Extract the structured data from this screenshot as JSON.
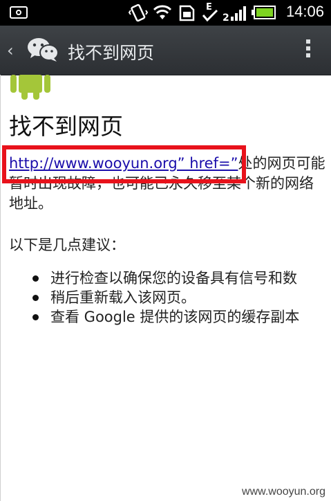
{
  "status_bar": {
    "time": "14:06",
    "icons": [
      "camera-icon",
      "vibrate-icon",
      "wifi-icon",
      "sd-card-icon",
      "check-icon",
      "signal-e-icon",
      "battery-icon"
    ]
  },
  "title_bar": {
    "back_glyph": "‹",
    "title": "找不到网页",
    "menu_icon": "overflow-menu-icon"
  },
  "page": {
    "heading": "找不到网页",
    "link_text": "http://www.wooyun.org” href=”",
    "message_rest": "处的网页可能暂时出现故障，也可能已永久移至某个新的网络地址。",
    "suggestions_title": "以下是几点建议：",
    "suggestions": [
      "进行检查以确保您的设备具有信号和数",
      "稍后重新载入该网页。",
      "查看 Google 提供的该网页的缓存副本"
    ]
  },
  "watermark": "www.wooyun.org",
  "colors": {
    "highlight_box": "#e8121b",
    "link": "#1a0dab",
    "android_green": "#a4c639"
  }
}
